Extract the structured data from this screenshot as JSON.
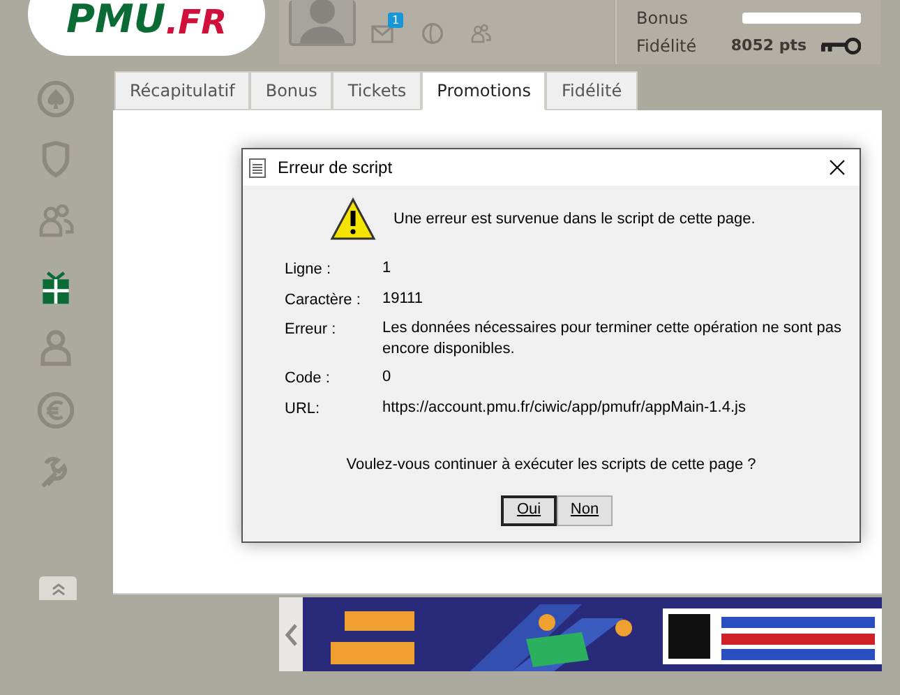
{
  "header": {
    "logo": {
      "brand": "PMU",
      "suffix": ".FR"
    },
    "mail_badge": "1",
    "account": [
      {
        "label": "Bonus",
        "kind": "bar"
      },
      {
        "label": "Fidélité",
        "kind": "points",
        "value": "8052 pts"
      }
    ]
  },
  "sidebar": {
    "items": [
      {
        "kind": "spade",
        "selected": false
      },
      {
        "kind": "shield",
        "selected": false
      },
      {
        "kind": "group",
        "selected": false
      },
      {
        "kind": "gift",
        "selected": true
      },
      {
        "kind": "person",
        "selected": false
      },
      {
        "kind": "euro",
        "selected": false
      },
      {
        "kind": "tools",
        "selected": false
      }
    ]
  },
  "tabs": [
    {
      "label": "Récapitulatif",
      "selected": false
    },
    {
      "label": "Bonus",
      "selected": false
    },
    {
      "label": "Tickets",
      "selected": false
    },
    {
      "label": "Promotions",
      "selected": true
    },
    {
      "label": "Fidélité",
      "selected": false
    }
  ],
  "dialog": {
    "title": "Erreur de script",
    "message": "Une erreur est survenue dans le script de cette page.",
    "details": [
      {
        "label": "Ligne :",
        "value": "1"
      },
      {
        "label": "Caractère :",
        "value": "19111"
      },
      {
        "label": "Erreur :",
        "value": "Les données nécessaires pour terminer cette opération ne sont pas encore disponibles."
      },
      {
        "label": "Code :",
        "value": "0"
      },
      {
        "label": "URL:",
        "value": "https://account.pmu.fr/ciwic/app/pmufr/appMain-1.4.js"
      }
    ],
    "question": "Voulez-vous continuer à exécuter les scripts de cette page ?",
    "buttons": [
      {
        "label": "Oui",
        "selected": true
      },
      {
        "label": "Non",
        "selected": false
      }
    ]
  }
}
